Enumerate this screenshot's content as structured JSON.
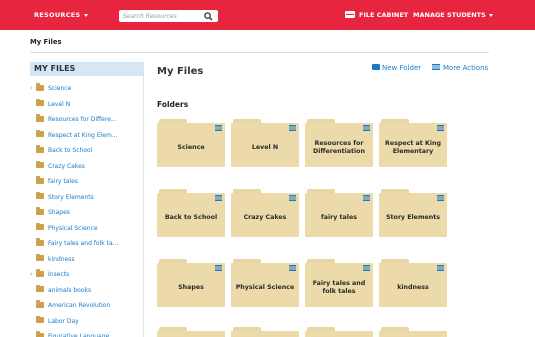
{
  "nav": {
    "resources_label": "RESOURCES",
    "search_placeholder": "Search Resources",
    "file_cabinet_label": "FILE CABINET",
    "manage_students_label": "MANAGE STUDENTS"
  },
  "breadcrumb": "My Files",
  "sidebar": {
    "title": "MY FILES",
    "items": [
      {
        "label": "Science",
        "expandable": true
      },
      {
        "label": "Level N",
        "expandable": false
      },
      {
        "label": "Resources for Differe...",
        "expandable": false
      },
      {
        "label": "Respect at King Elem...",
        "expandable": false
      },
      {
        "label": "Back to School",
        "expandable": false
      },
      {
        "label": "Crazy Cakes",
        "expandable": false
      },
      {
        "label": "fairy tales",
        "expandable": false
      },
      {
        "label": "Story Elements",
        "expandable": false
      },
      {
        "label": "Shapes",
        "expandable": false
      },
      {
        "label": "Physical Science",
        "expandable": false
      },
      {
        "label": "Fairy tales and folk ta...",
        "expandable": false
      },
      {
        "label": "kindness",
        "expandable": false
      },
      {
        "label": "Insects",
        "expandable": true
      },
      {
        "label": "animals books",
        "expandable": false
      },
      {
        "label": "American Revolution",
        "expandable": false
      },
      {
        "label": "Labor Day",
        "expandable": false
      },
      {
        "label": "Figurative Language",
        "expandable": false
      }
    ]
  },
  "main": {
    "title": "My Files",
    "new_folder_label": "New Folder",
    "more_actions_label": "More Actions",
    "folders_heading": "Folders",
    "folders": [
      "Science",
      "Level N",
      "Resources for Differentiation",
      "Respect at King Elementary",
      "Back to School",
      "Crazy Cakes",
      "fairy tales",
      "Story Elements",
      "Shapes",
      "Physical Science",
      "Fairy tales and folk tales",
      "kindness"
    ]
  },
  "colors": {
    "brand_red": "#e8253f",
    "link_blue": "#1a7ac6",
    "folder_tan": "#ecdaaa",
    "sidebar_header": "#d5e6f5"
  }
}
